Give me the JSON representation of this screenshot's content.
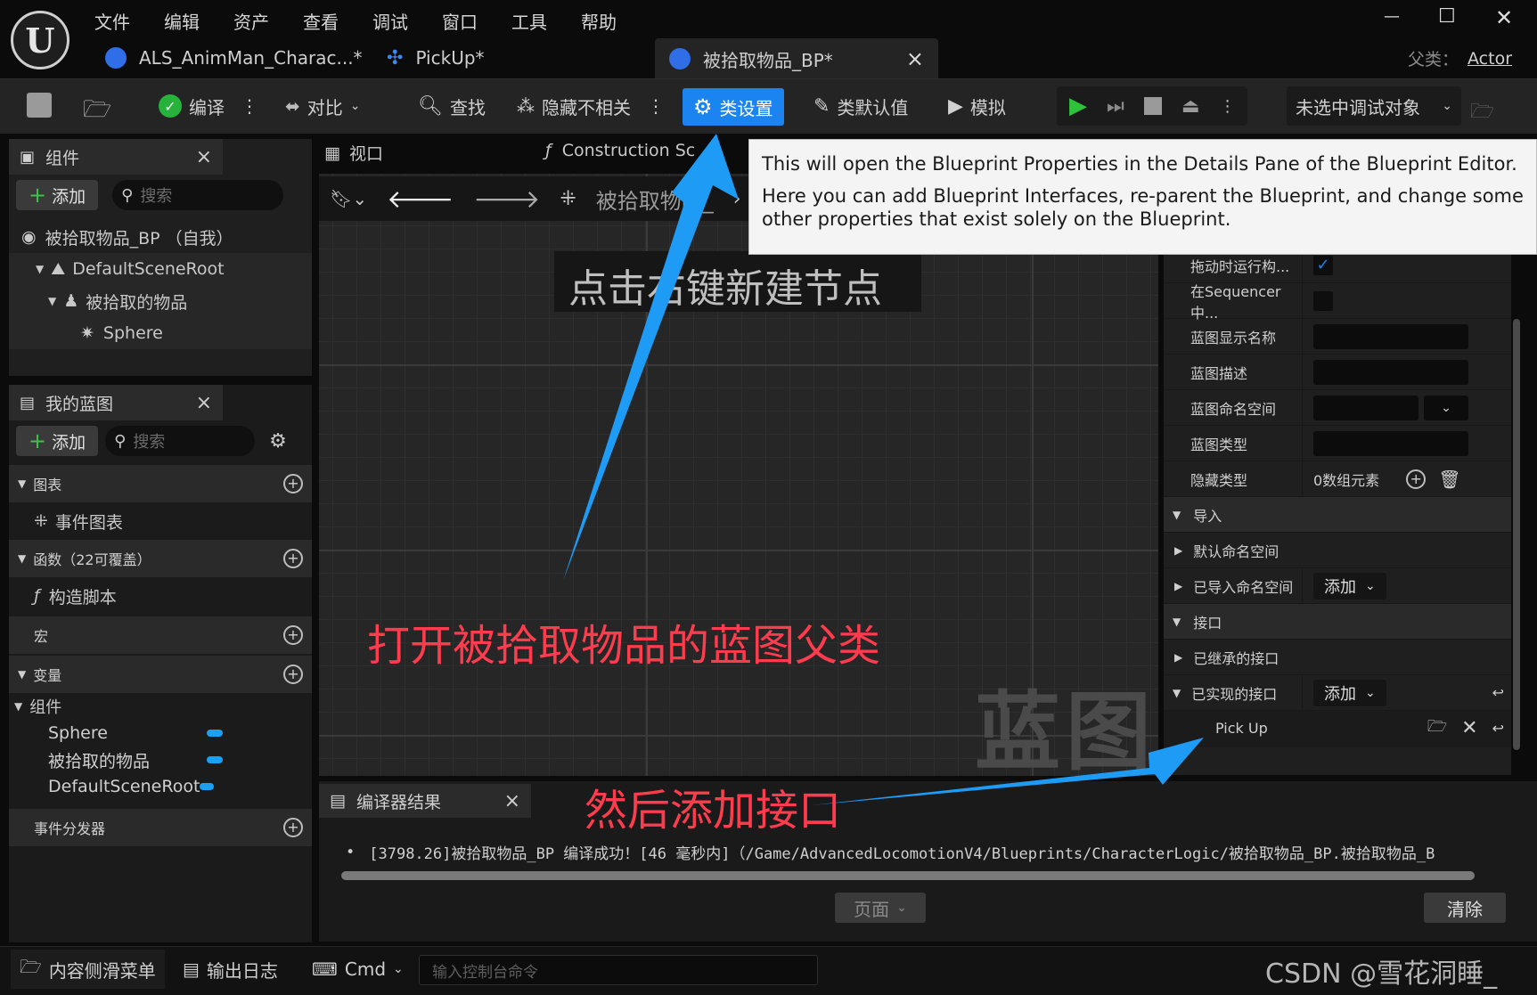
{
  "menu": [
    "文件",
    "编辑",
    "资产",
    "查看",
    "调试",
    "窗口",
    "工具",
    "帮助"
  ],
  "window_controls": {
    "minimize": "—",
    "maximize": "☐",
    "close": "✕"
  },
  "tabs": [
    {
      "label": "ALS_AnimMan_Charac...*"
    },
    {
      "label": "PickUp*"
    },
    {
      "label": "被拾取物品_BP*",
      "active": true
    }
  ],
  "tab_close": "×",
  "parent_class": {
    "label": "父类：",
    "value": "Actor"
  },
  "toolbar": {
    "compile": "编译",
    "diff": "对比",
    "find": "查找",
    "hide_unrelated": "隐藏不相关",
    "class_settings": "类设置",
    "class_defaults": "类默认值",
    "simulate": "模拟",
    "debug_target": "未选中调试对象"
  },
  "tooltip": {
    "line1": "This will open the Blueprint Properties in the Details Pane of the Blueprint Editor.",
    "line2": "Here you can add Blueprint Interfaces, re-parent the Blueprint, and change some other properties that exist solely on the Blueprint."
  },
  "components_panel": {
    "title": "组件",
    "add": "添加",
    "search_placeholder": "搜索",
    "tree": [
      {
        "label": "被拾取物品_BP （自我）"
      },
      {
        "label": "DefaultSceneRoot"
      },
      {
        "label": "被拾取的物品"
      },
      {
        "label": "Sphere"
      }
    ]
  },
  "my_blueprint": {
    "title": "我的蓝图",
    "add": "添加",
    "search_placeholder": "搜索",
    "sections": {
      "graphs": "图表",
      "event_graph": "事件图表",
      "functions": "函数（22可覆盖）",
      "construction_script": "构造脚本",
      "macros": "宏",
      "variables": "变量",
      "components_group": "组件",
      "dispatchers": "事件分发器"
    },
    "variables": [
      "Sphere",
      "被拾取的物品",
      "DefaultSceneRoot"
    ]
  },
  "viewport_tabs": {
    "viewport": "视口",
    "construction": "Construction Sc"
  },
  "graph": {
    "breadcrumb": "被拾取物品_",
    "watermark": "蓝图"
  },
  "annotations": {
    "top": "点击右键新建节点",
    "middle": "打开被拾取物品的蓝图父类",
    "bottom": "然后添加接口"
  },
  "details": {
    "rows_top": [
      {
        "label": "拖动时运行构...",
        "type": "checkbox_on"
      },
      {
        "label": "在Sequencer中...",
        "type": "checkbox_off"
      },
      {
        "label": "蓝图显示名称",
        "type": "field"
      },
      {
        "label": "蓝图描述",
        "type": "field"
      },
      {
        "label": "蓝图命名空间",
        "type": "dropdown"
      },
      {
        "label": "蓝图类型",
        "type": "field"
      }
    ],
    "hidden_types": {
      "label": "隐藏类型",
      "value": "0数组元素"
    },
    "imports": "导入",
    "default_namespace": "默认命名空间",
    "imported_namespace": "已导入命名空间",
    "add": "添加",
    "interfaces": "接口",
    "inherited": "已继承的接口",
    "implemented": "已实现的接口",
    "pickup": "Pick Up"
  },
  "compiler": {
    "title": "编译器结果",
    "log": "[3798.26]被拾取物品_BP 编译成功！[46 毫秒内]（/Game/AdvancedLocomotionV4/Blueprints/CharacterLogic/被拾取物品_BP.被拾取物品_B",
    "page": "页面",
    "clear": "清除"
  },
  "statusbar": {
    "content_drawer": "内容侧滑菜单",
    "output_log": "输出日志",
    "cmd": "Cmd",
    "console_placeholder": "输入控制台命令",
    "watermark": "CSDN @雪花洞睡_"
  },
  "colors": {
    "accent": "#1b84f0",
    "annotation_red": "#ff3b4e",
    "arrow": "#1e9bf5"
  }
}
